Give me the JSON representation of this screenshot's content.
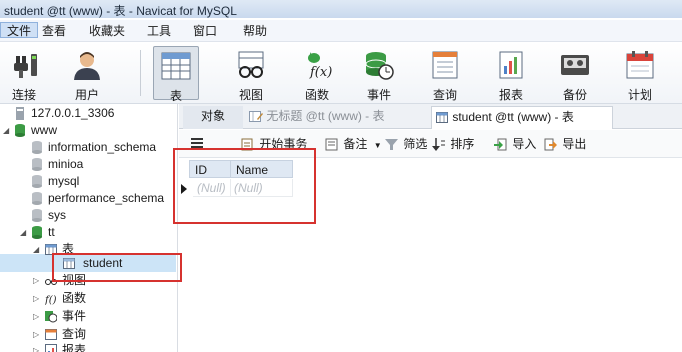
{
  "window": {
    "title": "student @tt (www) - 表 - Navicat for MySQL"
  },
  "menubar": {
    "items": [
      "文件",
      "查看",
      "收藏夹",
      "工具",
      "窗口",
      "帮助"
    ],
    "active_index": 0
  },
  "toolbar": {
    "buttons": [
      {
        "label": "连接",
        "icon": "plug-icon"
      },
      {
        "label": "用户",
        "icon": "user-icon"
      },
      {
        "label": "表",
        "icon": "table-icon",
        "active": true
      },
      {
        "label": "视图",
        "icon": "glasses-icon"
      },
      {
        "label": "函数",
        "icon": "function-icon"
      },
      {
        "label": "事件",
        "icon": "event-clock-icon"
      },
      {
        "label": "查询",
        "icon": "query-icon"
      },
      {
        "label": "报表",
        "icon": "report-icon"
      },
      {
        "label": "备份",
        "icon": "backup-tape-icon"
      },
      {
        "label": "计划",
        "icon": "calendar-icon"
      }
    ]
  },
  "tree": {
    "connection": "127.0.0.1_3306",
    "databases": [
      {
        "name": "www",
        "children": [
          "information_schema",
          "minioa",
          "mysql",
          "performance_schema",
          "sys"
        ]
      },
      {
        "name": "tt",
        "groups": [
          {
            "name": "表",
            "children": [
              "student"
            ]
          },
          {
            "name": "视图"
          },
          {
            "name": "函数"
          },
          {
            "name": "事件"
          },
          {
            "name": "查询"
          },
          {
            "name": "报表"
          }
        ]
      }
    ],
    "selected": "student"
  },
  "tabs": {
    "object": "对象",
    "untitled": "无标题 @tt (www) - 表",
    "current": "student @tt (www) - 表"
  },
  "subtoolbar": {
    "begin_transaction": "开始事务",
    "note": "备注",
    "filter": "筛选",
    "sort": "排序",
    "import": "导入",
    "export": "导出"
  },
  "grid": {
    "columns": [
      "ID",
      "Name"
    ],
    "rows": [
      [
        "(Null)",
        "(Null)"
      ]
    ]
  },
  "colors": {
    "accent": "#cfe0f5",
    "selection": "#cce4f7",
    "highlight_box": "#d6322f"
  }
}
